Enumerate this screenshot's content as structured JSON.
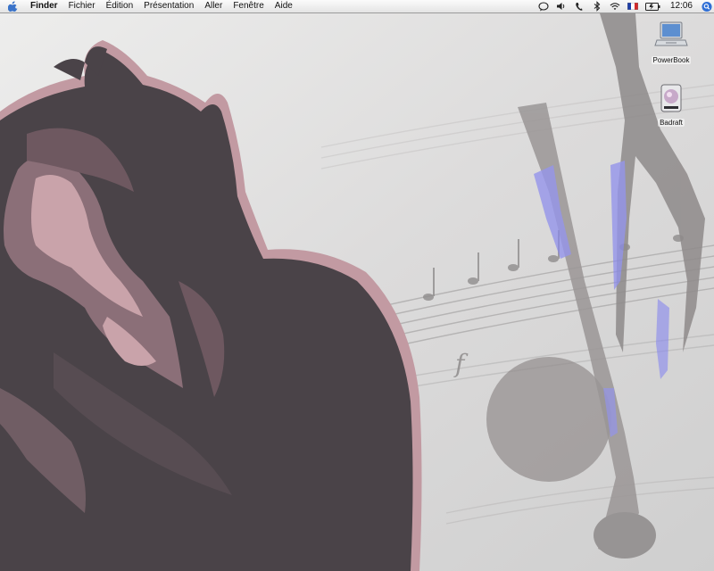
{
  "menubar": {
    "items": [
      {
        "label": "Finder",
        "bold": true
      },
      {
        "label": "Fichier"
      },
      {
        "label": "Édition"
      },
      {
        "label": "Présentation"
      },
      {
        "label": "Aller"
      },
      {
        "label": "Fenêtre"
      },
      {
        "label": "Aide"
      }
    ],
    "status_icons": [
      "ichat-icon",
      "volume-icon",
      "phone-icon",
      "bluetooth-icon",
      "wifi-icon",
      "french-flag-icon",
      "battery-icon"
    ],
    "clock": "12:06",
    "spotlight": "spotlight-icon"
  },
  "desktop": {
    "icons": [
      {
        "name": "powerbook-icon",
        "label": "PowerBook"
      },
      {
        "name": "drive-icon",
        "label": "Badraft"
      }
    ]
  },
  "colors": {
    "menubar": "#eeeeee",
    "figure_dark": "#4a4348",
    "figure_mid": "#8b6f78",
    "figure_light": "#c9a3aa",
    "note_gray": "#9a9696",
    "note_accent": "#8888ee"
  }
}
